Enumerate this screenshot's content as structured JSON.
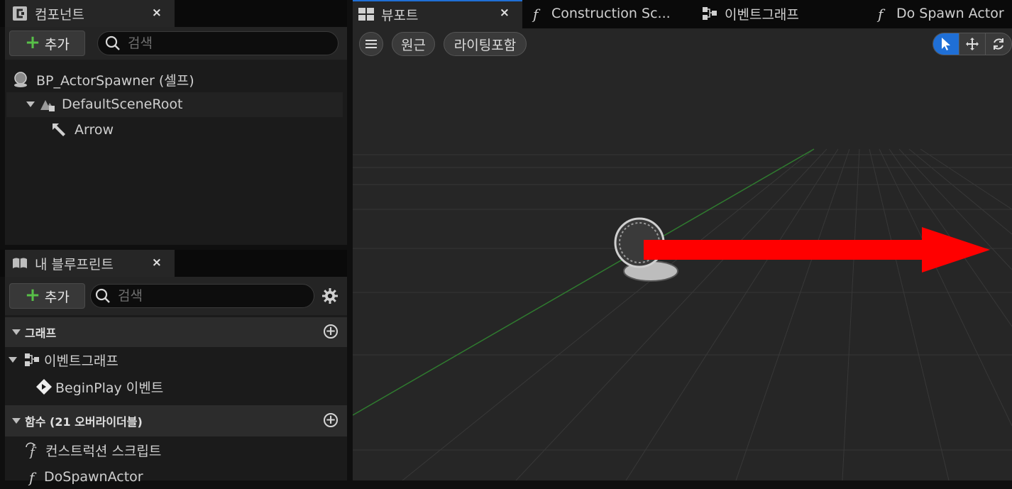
{
  "components_panel": {
    "tab_label": "컴포넌트",
    "close_glyph": "×",
    "add_label": "추가",
    "search_placeholder": "검색",
    "tree": [
      {
        "label": "BP_ActorSpawner (셀프)",
        "icon": "actor-sphere-icon"
      },
      {
        "label": "DefaultSceneRoot",
        "icon": "scene-root-icon"
      },
      {
        "label": "Arrow",
        "icon": "arrow-component-icon"
      }
    ]
  },
  "my_blueprint_panel": {
    "tab_label": "내 블루프린트",
    "close_glyph": "×",
    "add_label": "추가",
    "search_placeholder": "검색",
    "sections": {
      "graphs": {
        "title": "그래프",
        "items": [
          {
            "label": "이벤트그래프",
            "icon": "event-graph-icon"
          },
          {
            "label": "BeginPlay 이벤트",
            "icon": "event-node-icon"
          }
        ]
      },
      "functions": {
        "title": "함수 (21 오버라이더블)",
        "items": [
          {
            "label": "컨스트럭션 스크립트",
            "icon": "construction-function-icon"
          },
          {
            "label": "DoSpawnActor",
            "icon": "function-icon"
          }
        ]
      }
    }
  },
  "editor_tabs": [
    {
      "label": "뷰포트",
      "icon": "viewport-icon",
      "active": true,
      "close_glyph": "×"
    },
    {
      "label": "Construction Sc...",
      "icon": "function-icon"
    },
    {
      "label": "이벤트그래프",
      "icon": "event-graph-icon"
    },
    {
      "label": "Do Spawn Actor",
      "icon": "function-icon"
    }
  ],
  "viewport_toolbar": {
    "menu_icon": "hamburger-menu-icon",
    "perspective_label": "원근",
    "lit_label": "라이팅포함",
    "tools": [
      "select-icon",
      "translate-icon",
      "rotate-icon"
    ]
  },
  "colors": {
    "accent": "#1f6fd6",
    "add_plus": "#58c048",
    "arrow_red": "#ff0000",
    "grid_line": "#3c3c3c",
    "x_axis": "#2f7a2f"
  }
}
